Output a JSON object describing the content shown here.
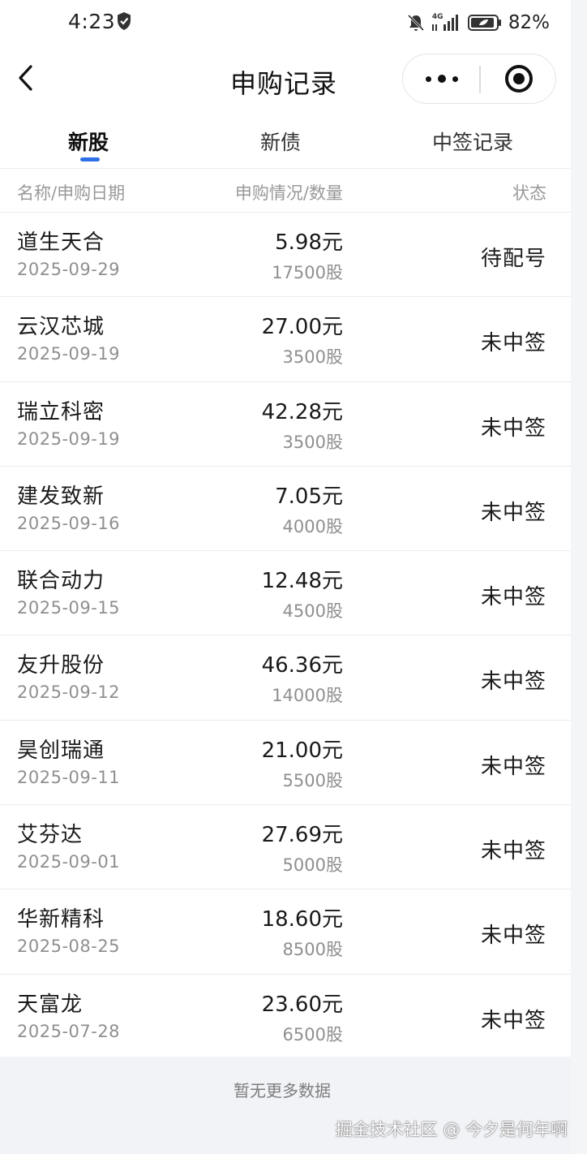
{
  "status_bar": {
    "time": "4:23",
    "network": "4G",
    "battery": "82%"
  },
  "header": {
    "title": "申购记录"
  },
  "tabs": [
    {
      "label": "新股",
      "active": true
    },
    {
      "label": "新债",
      "active": false
    },
    {
      "label": "中签记录",
      "active": false
    }
  ],
  "columns": {
    "name_date": "名称/申购日期",
    "price_qty": "申购情况/数量",
    "status": "状态"
  },
  "records": [
    {
      "name": "道生天合",
      "date": "2025-09-29",
      "price": "5.98元",
      "qty": "17500股",
      "status": "待配号"
    },
    {
      "name": "云汉芯城",
      "date": "2025-09-19",
      "price": "27.00元",
      "qty": "3500股",
      "status": "未中签"
    },
    {
      "name": "瑞立科密",
      "date": "2025-09-19",
      "price": "42.28元",
      "qty": "3500股",
      "status": "未中签"
    },
    {
      "name": "建发致新",
      "date": "2025-09-16",
      "price": "7.05元",
      "qty": "4000股",
      "status": "未中签"
    },
    {
      "name": "联合动力",
      "date": "2025-09-15",
      "price": "12.48元",
      "qty": "4500股",
      "status": "未中签"
    },
    {
      "name": "友升股份",
      "date": "2025-09-12",
      "price": "46.36元",
      "qty": "14000股",
      "status": "未中签"
    },
    {
      "name": "昊创瑞通",
      "date": "2025-09-11",
      "price": "21.00元",
      "qty": "5500股",
      "status": "未中签"
    },
    {
      "name": "艾芬达",
      "date": "2025-09-01",
      "price": "27.69元",
      "qty": "5000股",
      "status": "未中签"
    },
    {
      "name": "华新精科",
      "date": "2025-08-25",
      "price": "18.60元",
      "qty": "8500股",
      "status": "未中签"
    },
    {
      "name": "天富龙",
      "date": "2025-07-28",
      "price": "23.60元",
      "qty": "6500股",
      "status": "未中签"
    }
  ],
  "footer": {
    "note": "暂无更多数据"
  },
  "watermark": "掘金技术社区 @ 今夕是何年啊",
  "colors": {
    "accent": "#2f6fe8",
    "background": "#f2f3f7",
    "text_secondary": "#8f8f8f"
  }
}
